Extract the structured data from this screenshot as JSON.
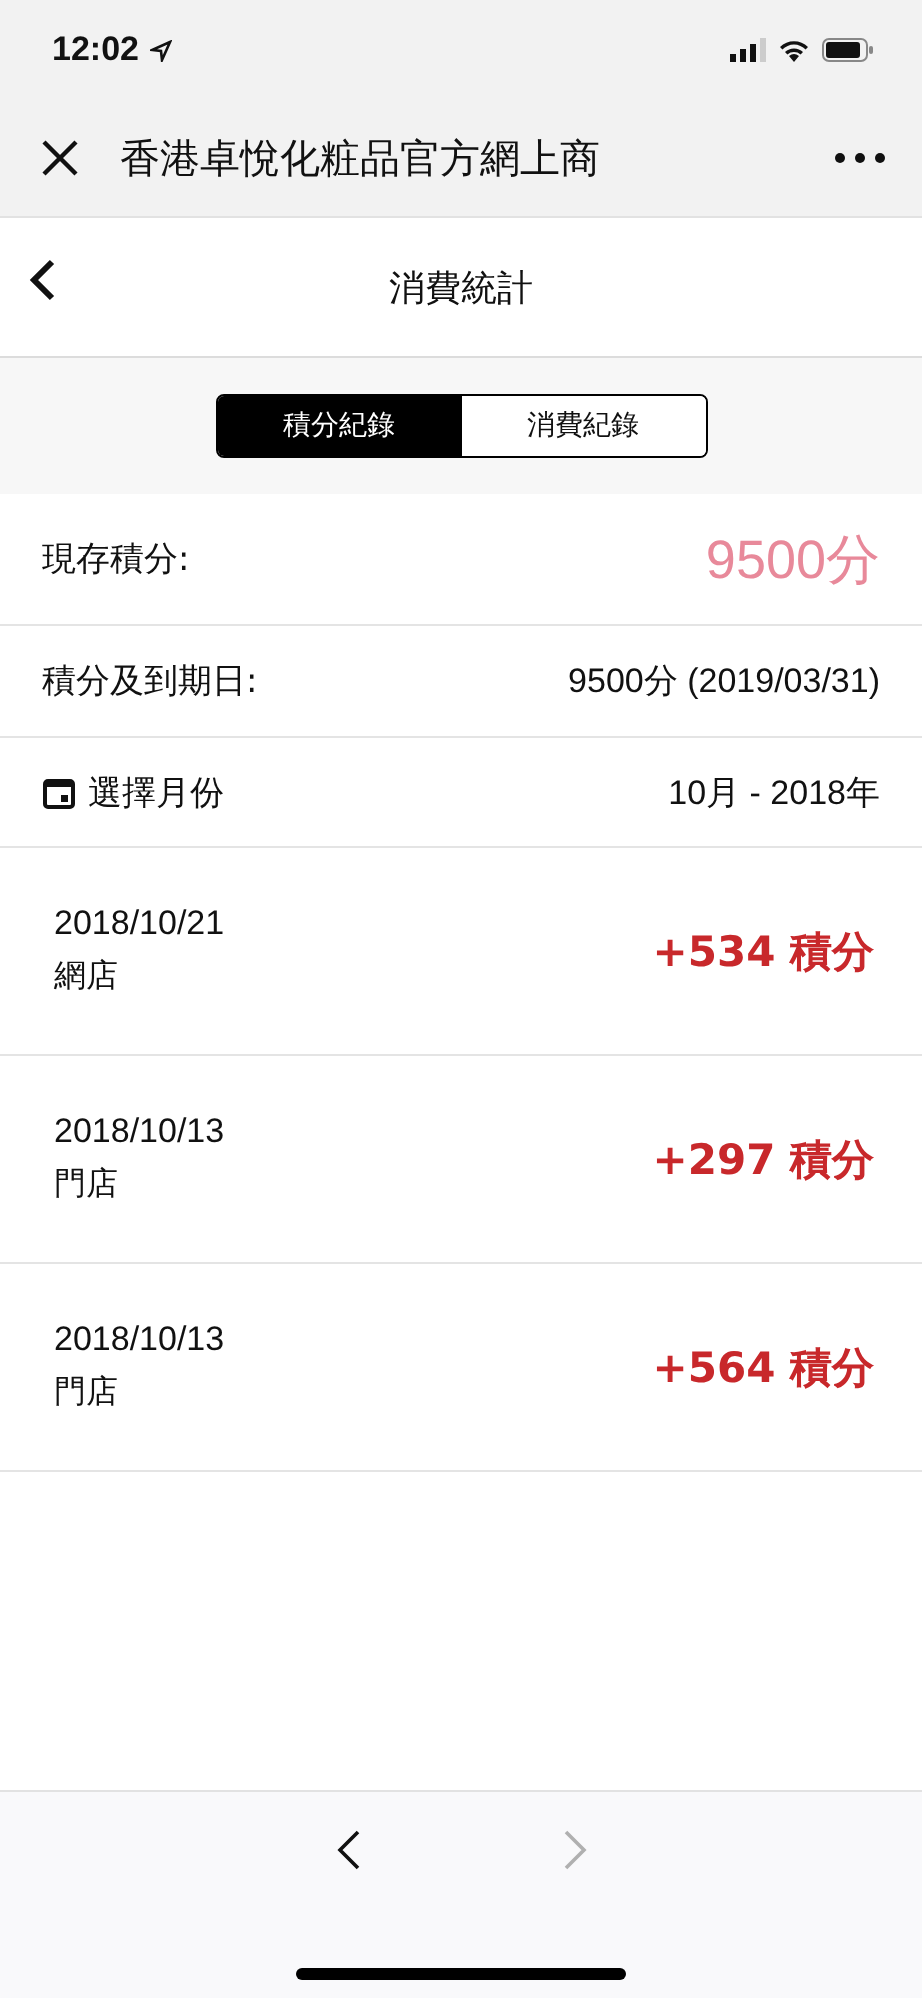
{
  "status_bar": {
    "time": "12:02"
  },
  "browser_bar": {
    "title": "香港卓悅化粧品官方網上商"
  },
  "header": {
    "title": "消費統計"
  },
  "tabs": [
    {
      "label": "積分紀錄",
      "selected": true
    },
    {
      "label": "消費紀錄",
      "selected": false
    }
  ],
  "summary": [
    {
      "label": "現存積分:",
      "value": "9500分",
      "kind": "highlight"
    },
    {
      "label": "積分及到期日:",
      "value": "9500分 (2019/03/31)",
      "kind": "plain"
    },
    {
      "label": "選擇月份",
      "value": "10月 - 2018年",
      "kind": "picker"
    }
  ],
  "records": [
    {
      "date": "2018/10/21",
      "source": "網店",
      "points": "+534 積分"
    },
    {
      "date": "2018/10/13",
      "source": "門店",
      "points": "+297 積分"
    },
    {
      "date": "2018/10/13",
      "source": "門店",
      "points": "+564 積分"
    }
  ],
  "toolbar": {
    "back": {
      "disabled": false
    },
    "forward": {
      "disabled": true
    }
  }
}
